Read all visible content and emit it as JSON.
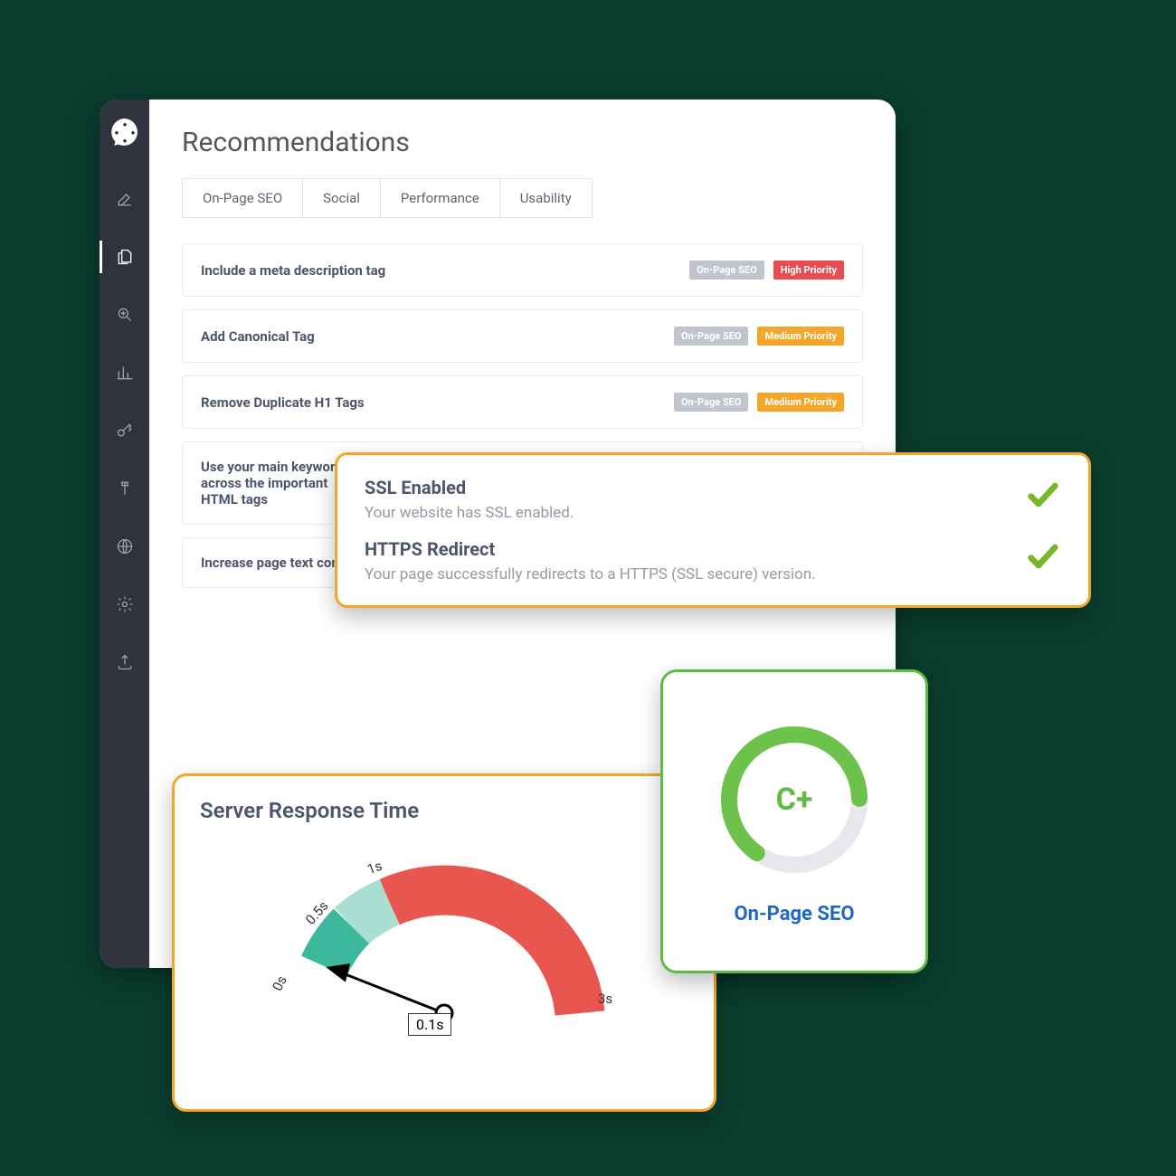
{
  "page": {
    "title": "Recommendations"
  },
  "tabs": {
    "t0": "On-Page SEO",
    "t1": "Social",
    "t2": "Performance",
    "t3": "Usability"
  },
  "recs": [
    {
      "title": "Include a meta description tag",
      "cat": "On-Page SEO",
      "prio": "High Priority",
      "prio_level": "hi"
    },
    {
      "title": "Add Canonical Tag",
      "cat": "On-Page SEO",
      "prio": "Medium Priority",
      "prio_level": "med"
    },
    {
      "title": "Remove Duplicate H1 Tags",
      "cat": "On-Page SEO",
      "prio": "Medium Priority",
      "prio_level": "med"
    },
    {
      "title": "Use your main keywords across the important HTML tags",
      "cat": "",
      "prio": "",
      "prio_level": ""
    },
    {
      "title": "Increase page text content",
      "cat": "",
      "prio": "",
      "prio_level": ""
    }
  ],
  "ssl": {
    "r0_title": "SSL Enabled",
    "r0_desc": "Your website has SSL enabled.",
    "r1_title": "HTTPS Redirect",
    "r1_desc": "Your page successfully redirects to a HTTPS (SSL secure) version."
  },
  "grade": {
    "value": "C+",
    "label": "On-Page SEO"
  },
  "gauge": {
    "title": "Server Response Time",
    "value_label": "0.1s",
    "ticks": {
      "t0": "0s",
      "t1": "0.5s",
      "t2": "1s",
      "t3": "3s"
    }
  },
  "chart_data": [
    {
      "type": "gauge",
      "title": "Server Response Time",
      "value": 0.1,
      "unit": "s",
      "ticks": [
        0,
        0.5,
        1,
        3
      ],
      "segments": [
        {
          "from": 0,
          "to": 0.5,
          "color": "#3cb99c",
          "meaning": "good"
        },
        {
          "from": 0.5,
          "to": 1,
          "color": "#a9dfd0",
          "meaning": "ok"
        },
        {
          "from": 1,
          "to": 3,
          "color": "#e9564f",
          "meaning": "bad"
        }
      ]
    },
    {
      "type": "donut_progress",
      "title": "On-Page SEO",
      "grade": "C+",
      "percent": 65,
      "color": "#60bb46"
    }
  ]
}
